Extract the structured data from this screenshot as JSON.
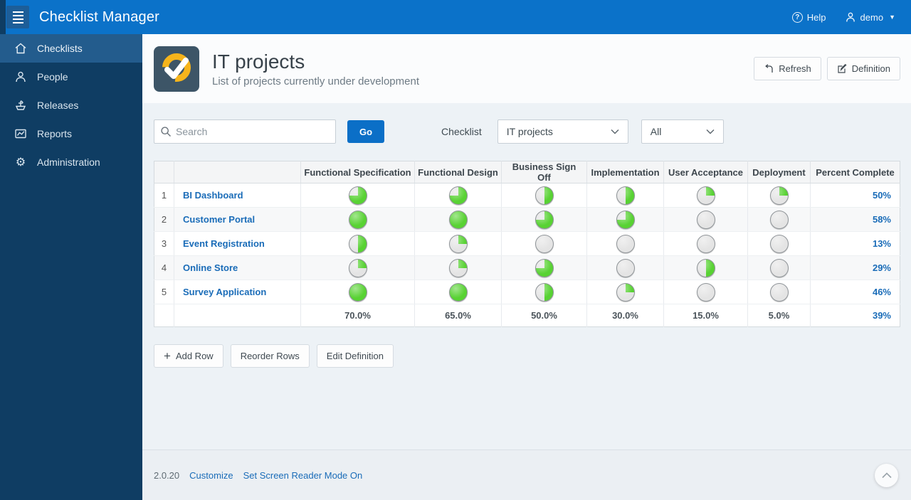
{
  "topbar": {
    "app_title": "Checklist Manager",
    "help_label": "Help",
    "user_label": "demo"
  },
  "sidebar": {
    "items": [
      {
        "label": "Checklists",
        "icon": "home-icon",
        "active": true
      },
      {
        "label": "People",
        "icon": "person-icon",
        "active": false
      },
      {
        "label": "Releases",
        "icon": "ship-icon",
        "active": false
      },
      {
        "label": "Reports",
        "icon": "chart-icon",
        "active": false
      },
      {
        "label": "Administration",
        "icon": "gear-icon",
        "active": false
      }
    ]
  },
  "page_header": {
    "title": "IT projects",
    "subtitle": "List of projects currently under development",
    "refresh_label": "Refresh",
    "definition_label": "Definition"
  },
  "filters": {
    "search_placeholder": "Search",
    "go_label": "Go",
    "checklist_label": "Checklist",
    "checklist_value": "IT projects",
    "scope_value": "All"
  },
  "table": {
    "columns": [
      "",
      "",
      "Functional Specification",
      "Functional Design",
      "Business Sign Off",
      "Implementation",
      "User Acceptance",
      "Deployment",
      "Percent Complete"
    ],
    "rows": [
      {
        "num": "1",
        "name": "BI Dashboard",
        "pies": [
          75,
          75,
          50,
          50,
          25,
          25
        ],
        "percent": "50%"
      },
      {
        "num": "2",
        "name": "Customer Portal",
        "pies": [
          100,
          100,
          75,
          75,
          0,
          0
        ],
        "percent": "58%"
      },
      {
        "num": "3",
        "name": "Event Registration",
        "pies": [
          50,
          25,
          0,
          0,
          0,
          0
        ],
        "percent": "13%"
      },
      {
        "num": "4",
        "name": "Online Store",
        "pies": [
          25,
          25,
          75,
          0,
          50,
          0
        ],
        "percent": "29%"
      },
      {
        "num": "5",
        "name": "Survey Application",
        "pies": [
          100,
          100,
          50,
          25,
          0,
          0
        ],
        "percent": "46%"
      }
    ],
    "summary": {
      "values": [
        "70.0%",
        "65.0%",
        "50.0%",
        "30.0%",
        "15.0%",
        "5.0%"
      ],
      "percent": "39%"
    }
  },
  "actions": {
    "add_row": "Add Row",
    "reorder_rows": "Reorder Rows",
    "edit_definition": "Edit Definition"
  },
  "footer": {
    "version": "2.0.20",
    "customize": "Customize",
    "screen_reader": "Set Screen Reader Mode On"
  },
  "colors": {
    "topbar_blue": "#0b72c9",
    "sidebar_navy": "#0f3d63",
    "active_item_blue": "#235c8d",
    "link_blue": "#1a6cb8",
    "go_button_blue": "#0b6fc7",
    "pie_green": "#58d233",
    "pie_gray": "#e4e4e4",
    "icon_yellow": "#f6b41b",
    "icon_slate": "#3d5567"
  }
}
